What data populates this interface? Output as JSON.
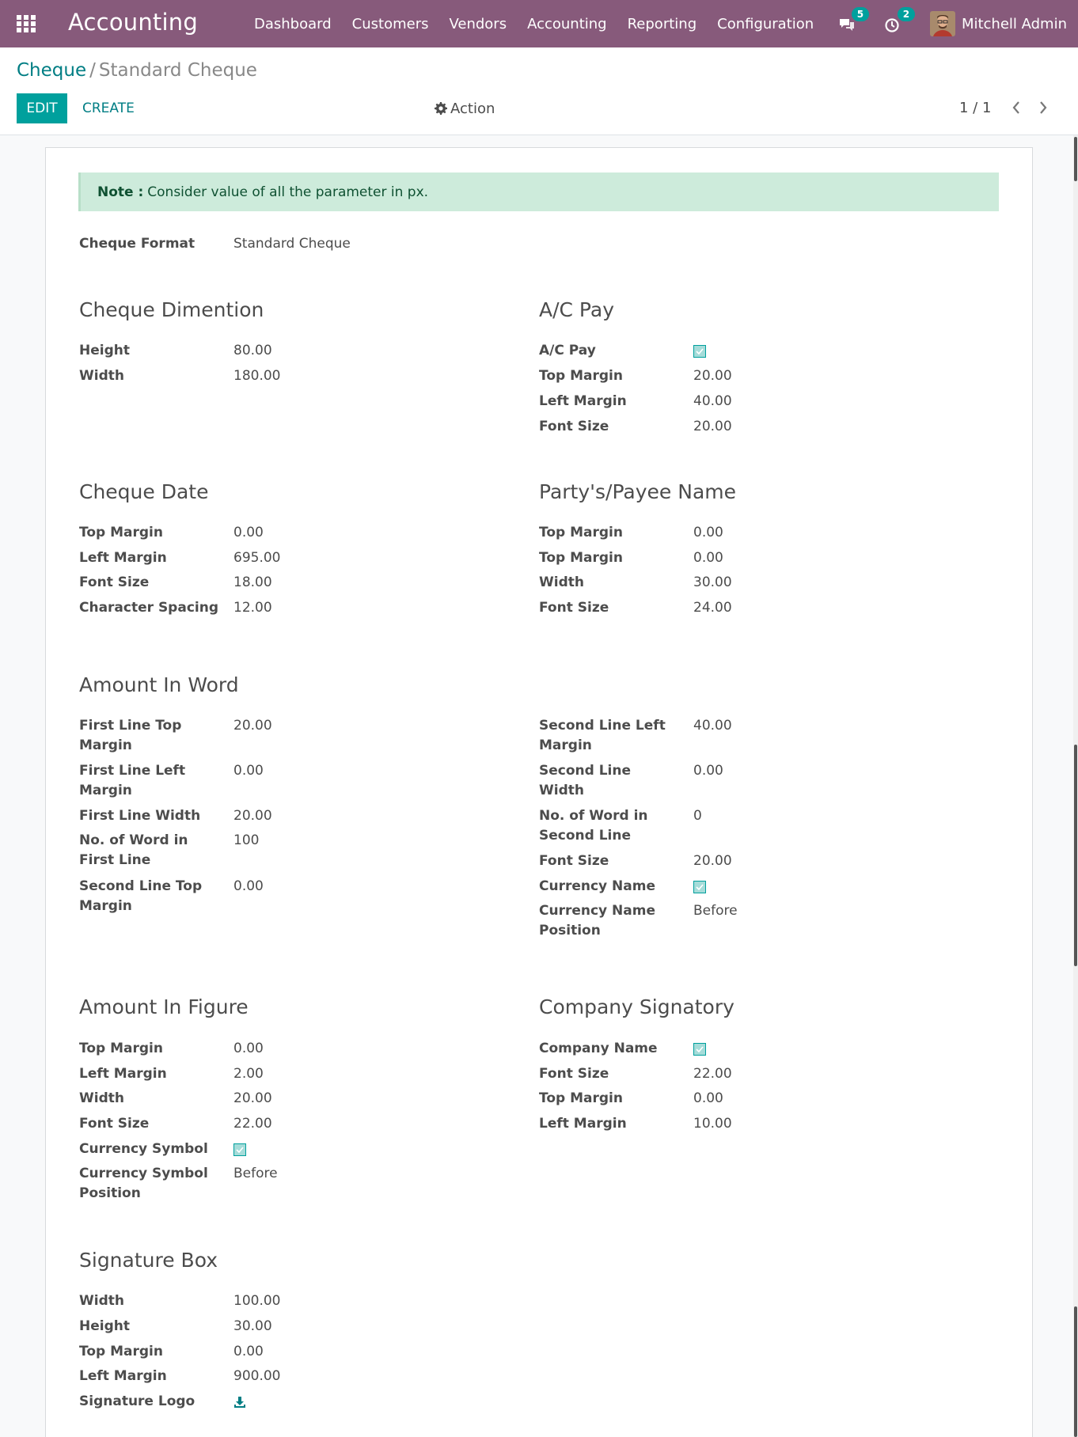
{
  "navbar": {
    "app_title": "Accounting",
    "menu": [
      "Dashboard",
      "Customers",
      "Vendors",
      "Accounting",
      "Reporting",
      "Configuration"
    ],
    "messages_count": "5",
    "activities_count": "2",
    "user_name": "Mitchell Admin"
  },
  "control_panel": {
    "breadcrumb_parent": "Cheque",
    "breadcrumb_separator": "/",
    "breadcrumb_current": "Standard Cheque",
    "edit_label": "EDIT",
    "create_label": "CREATE",
    "action_label": "Action",
    "pager": "1 / 1"
  },
  "note": {
    "label": "Note :",
    "text": "Consider value of all the parameter in px."
  },
  "cheque_format": {
    "label": "Cheque Format",
    "value": "Standard Cheque"
  },
  "groups": {
    "dimension": {
      "title": "Cheque Dimention",
      "fields": [
        {
          "label": "Height",
          "value": "80.00"
        },
        {
          "label": "Width",
          "value": "180.00"
        }
      ]
    },
    "ac_pay": {
      "title": "A/C Pay",
      "fields": [
        {
          "label": "A/C Pay",
          "value": "",
          "checked": true
        },
        {
          "label": "Top Margin",
          "value": "20.00"
        },
        {
          "label": "Left Margin",
          "value": "40.00"
        },
        {
          "label": "Font Size",
          "value": "20.00"
        }
      ]
    },
    "date": {
      "title": "Cheque Date",
      "fields": [
        {
          "label": "Top Margin",
          "value": "0.00"
        },
        {
          "label": "Left Margin",
          "value": "695.00"
        },
        {
          "label": "Font Size",
          "value": "18.00"
        },
        {
          "label": "Character Spacing",
          "value": "12.00"
        }
      ]
    },
    "payee": {
      "title": "Party's/Payee Name",
      "fields": [
        {
          "label": "Top Margin",
          "value": "0.00"
        },
        {
          "label": "Top Margin",
          "value": "0.00"
        },
        {
          "label": "Width",
          "value": "30.00"
        },
        {
          "label": "Font Size",
          "value": "24.00"
        }
      ]
    },
    "amount_word": {
      "title": "Amount In Word",
      "left_fields": [
        {
          "label": "First Line Top Margin",
          "value": "20.00"
        },
        {
          "label": "First Line Left Margin",
          "value": "0.00"
        },
        {
          "label": "First Line Width",
          "value": "20.00"
        },
        {
          "label": "No. of Word in First Line",
          "value": "100"
        },
        {
          "label": "Second Line Top Margin",
          "value": "0.00"
        }
      ],
      "right_fields": [
        {
          "label": "Second Line Left Margin",
          "value": "40.00"
        },
        {
          "label": "Second Line Width",
          "value": "0.00"
        },
        {
          "label": "No. of Word in Second Line",
          "value": "0"
        },
        {
          "label": "Font Size",
          "value": "20.00"
        },
        {
          "label": "Currency Name",
          "value": "",
          "checked": true
        },
        {
          "label": "Currency Name Position",
          "value": "Before"
        }
      ]
    },
    "amount_figure": {
      "title": "Amount In Figure",
      "fields": [
        {
          "label": "Top Margin",
          "value": "0.00"
        },
        {
          "label": "Left Margin",
          "value": "2.00"
        },
        {
          "label": "Width",
          "value": "20.00"
        },
        {
          "label": "Font Size",
          "value": "22.00"
        },
        {
          "label": "Currency Symbol",
          "value": "",
          "checked": true
        },
        {
          "label": "Currency Symbol Position",
          "value": "Before"
        }
      ]
    },
    "signatory": {
      "title": "Company Signatory",
      "fields": [
        {
          "label": "Company Name",
          "value": "",
          "checked": true
        },
        {
          "label": "Font Size",
          "value": "22.00"
        },
        {
          "label": "Top Margin",
          "value": "0.00"
        },
        {
          "label": "Left Margin",
          "value": "10.00"
        }
      ]
    },
    "signature_box": {
      "title": "Signature Box",
      "fields": [
        {
          "label": "Width",
          "value": "100.00"
        },
        {
          "label": "Height",
          "value": "30.00"
        },
        {
          "label": "Top Margin",
          "value": "0.00"
        },
        {
          "label": "Left Margin",
          "value": "900.00"
        },
        {
          "label": "Signature Logo",
          "value": "",
          "icon": "download-icon"
        }
      ]
    }
  },
  "colors": {
    "navbar": "#875a7b",
    "primary": "#00a09d",
    "link": "#017e84",
    "note_bg": "#cdebdb"
  }
}
